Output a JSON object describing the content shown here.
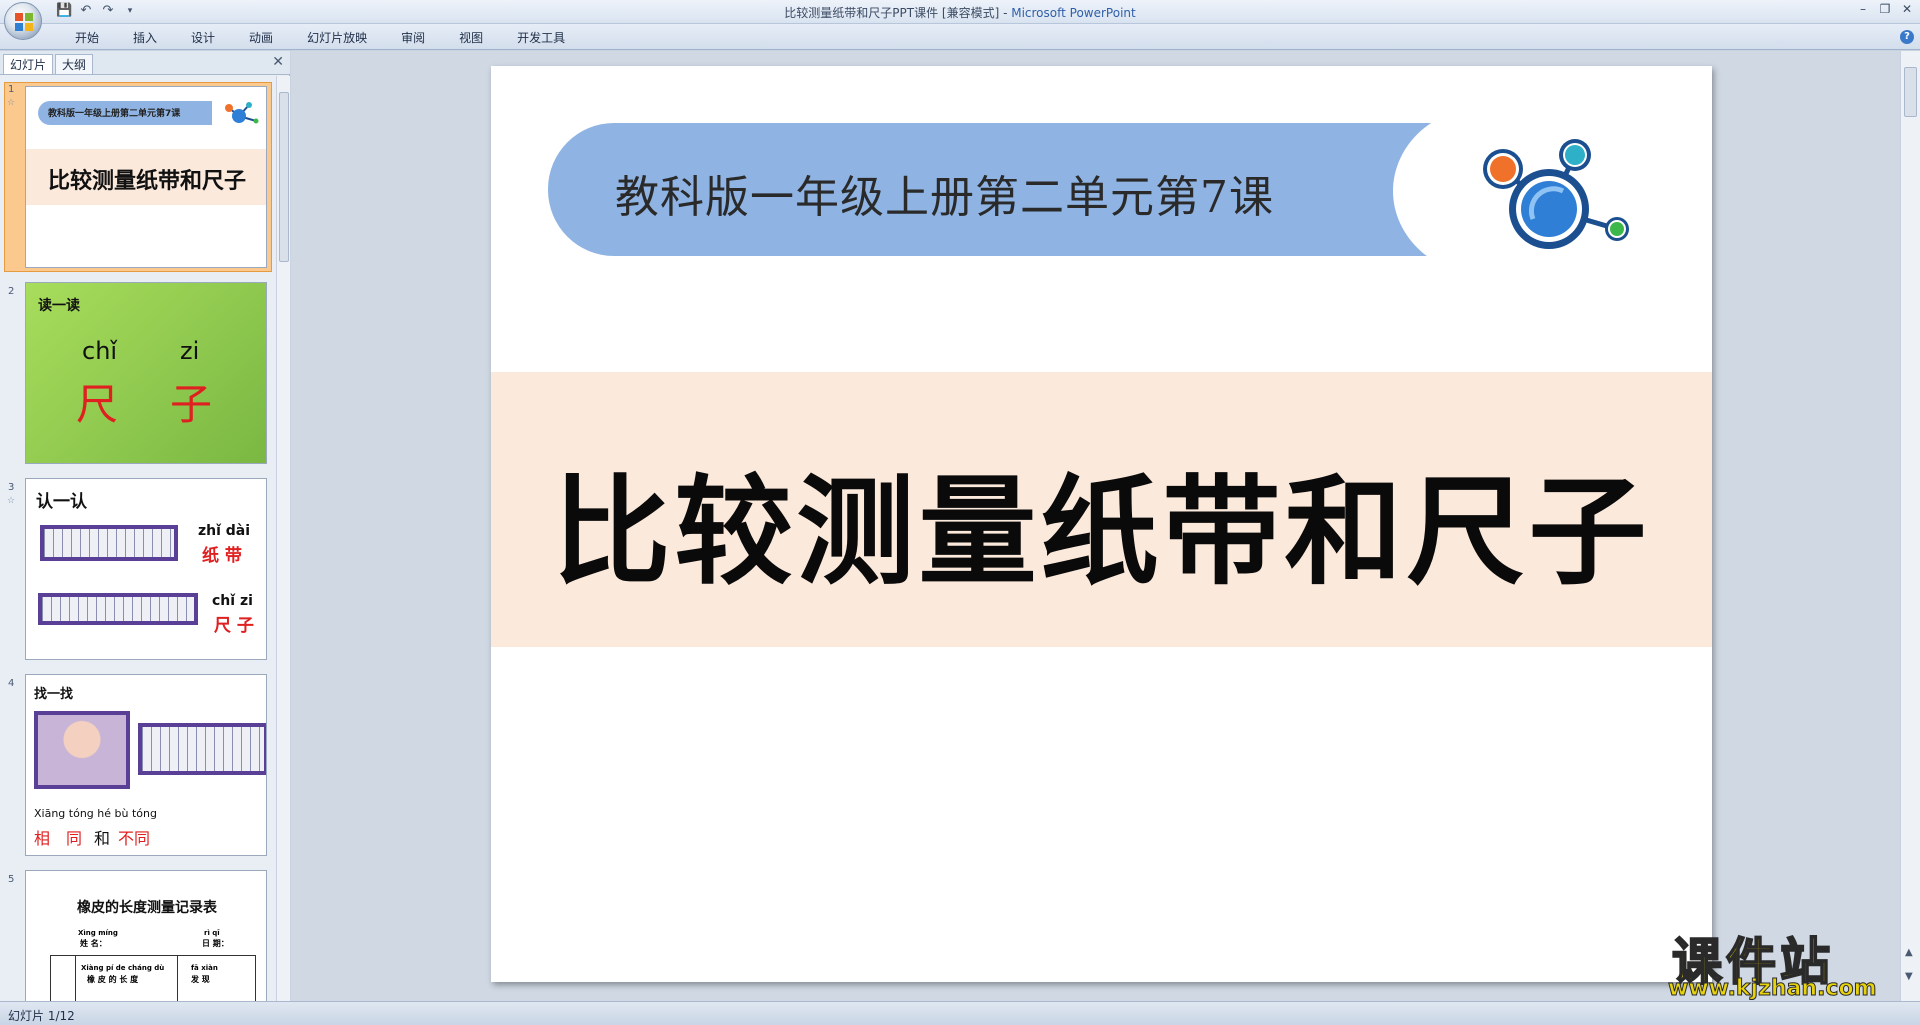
{
  "window": {
    "title": "比较测量纸带和尺子PPT课件 [兼容模式]",
    "separator": " - ",
    "app_name": "Microsoft PowerPoint"
  },
  "ribbon": {
    "tabs": [
      "开始",
      "插入",
      "设计",
      "动画",
      "幻灯片放映",
      "审阅",
      "视图",
      "开发工具"
    ]
  },
  "left_panel": {
    "tabs": [
      "幻灯片",
      "大纲"
    ],
    "slides": [
      {
        "num": "1",
        "subtitle": "教科版一年级上册第二单元第7课",
        "title": "比较测量纸带和尺子"
      },
      {
        "num": "2",
        "heading": "读一读",
        "pinyin": [
          "chǐ",
          "zi"
        ],
        "chars": [
          "尺",
          "子"
        ]
      },
      {
        "num": "3",
        "heading": "认一认",
        "items": [
          {
            "pinyin": "zhǐ dài",
            "chars": "纸 带"
          },
          {
            "pinyin": "chǐ zi",
            "chars": "尺 子"
          }
        ]
      },
      {
        "num": "4",
        "heading": "找一找",
        "pinyin_line": "Xiāng tóng hé   bù  tóng",
        "chars": [
          "相",
          "同",
          "和",
          "不同"
        ]
      },
      {
        "num": "5",
        "heading": "橡皮的长度测量记录表",
        "labels": [
          "Xìng míng",
          "姓 名：",
          "rì  qī",
          "日 期：",
          "Xiàng pí  de cháng dù",
          "橡 皮 的 长 度",
          "fā  xiàn",
          "发 现"
        ]
      }
    ]
  },
  "slide": {
    "subtitle": "教科版一年级上册第二单元第7课",
    "title": "比较测量纸带和尺子"
  },
  "watermark": {
    "top": "课件站",
    "bottom": "www.kjzhan.com"
  },
  "status": {
    "text": "幻灯片 1/12"
  }
}
